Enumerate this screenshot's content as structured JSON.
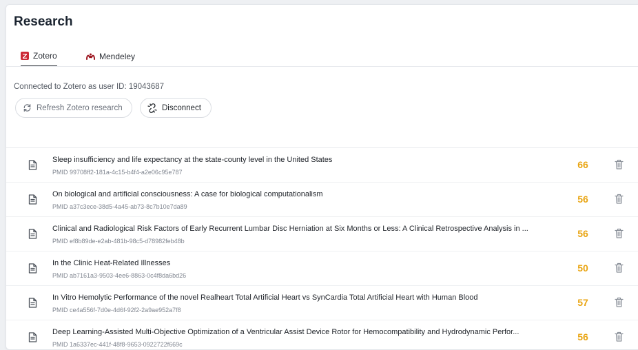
{
  "page": {
    "title": "Research"
  },
  "tabs": [
    {
      "label": "Zotero",
      "icon": "zotero-icon",
      "active": true
    },
    {
      "label": "Mendeley",
      "icon": "mendeley-icon",
      "active": false
    }
  ],
  "status": {
    "connected_text": "Connected to Zotero as user ID: 19043687"
  },
  "buttons": {
    "refresh_label": "Refresh Zotero research",
    "disconnect_label": "Disconnect"
  },
  "colors": {
    "accent_score": "#e9a513",
    "zotero_red": "#cc2936",
    "mendeley_red": "#9d1620"
  },
  "papers": [
    {
      "title": "Sleep insufficiency and life expectancy at the state-county level in the United States",
      "pmid": "PMID 99708ff2-181a-4c15-b4f4-a2e06c95e787",
      "score": "66"
    },
    {
      "title": "On biological and artificial consciousness: A case for biological computationalism",
      "pmid": "PMID a37c3ece-38d5-4a45-ab73-8c7b10e7da89",
      "score": "56"
    },
    {
      "title": "Clinical and Radiological Risk Factors of Early Recurrent Lumbar Disc Herniation at Six Months or Less: A Clinical Retrospective Analysis in ...",
      "pmid": "PMID ef8b89de-e2ab-481b-98c5-d78982feb48b",
      "score": "56"
    },
    {
      "title": "In the Clinic Heat-Related Illnesses",
      "pmid": "PMID ab7161a3-9503-4ee6-8863-0c4f8da6bd26",
      "score": "50"
    },
    {
      "title": "In Vitro Hemolytic Performance of the novel Realheart Total Artificial Heart vs SynCardia Total Artificial Heart with Human Blood",
      "pmid": "PMID ce4a556f-7d0e-4d6f-92f2-2a9ae952a7f8",
      "score": "57"
    },
    {
      "title": "Deep Learning-Assisted Multi-Objective Optimization of a Ventricular Assist Device Rotor for Hemocompatibility and Hydrodynamic Perfor...",
      "pmid": "PMID 1a6337ec-441f-48f8-9653-0922722f669c",
      "score": "56"
    }
  ]
}
